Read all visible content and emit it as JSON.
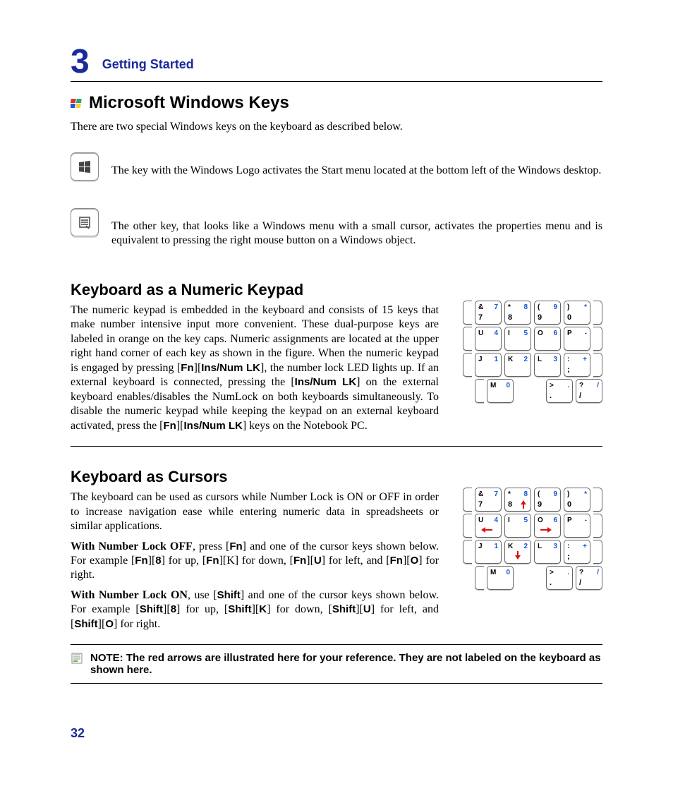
{
  "chapter": {
    "number": "3",
    "title": "Getting Started"
  },
  "section1": {
    "heading": "Microsoft Windows Keys",
    "intro": "There are two special Windows keys on the keyboard as described below.",
    "key1": "The key with the Windows Logo activates the Start menu located at the bottom left of the Windows desktop.",
    "key2": "The other key, that looks like a Windows menu with a small cursor, activates the properties menu and is equivalent to pressing the right mouse button on a Windows object."
  },
  "section2": {
    "heading": "Keyboard as a Numeric Keypad",
    "para_a": "The numeric keypad is embedded in the keyboard and consists of 15 keys that make number intensive input more convenient. These dual-purpose keys are labeled in orange on the key caps. Numeric assignments are located at the upper right hand corner of each key as shown in the figure. When the numeric keypad is engaged by pressing [",
    "para_b": "Fn",
    "para_c": "][",
    "para_d": "Ins/Num LK",
    "para_e": "], the number lock LED lights up. If an external keyboard is connected, pressing the [",
    "para_f": "Ins/Num LK",
    "para_g": "] on the external keyboard enables/disables the NumLock on both keyboards simultaneously. To disable the numeric keypad while keeping the keypad on an external keyboard activated, press the  [",
    "para_h": "Fn",
    "para_i": "][",
    "para_j": "Ins/Num LK",
    "para_k": "] keys on the Notebook PC."
  },
  "section3": {
    "heading": "Keyboard as Cursors",
    "p1": "The keyboard can be used as cursors while Number Lock is ON or OFF in order to increase navigation ease while entering numeric data in spreadsheets or similar applications.",
    "p2_a": "With Number Lock OFF",
    "p2_b": ", press [",
    "p2_c": "Fn",
    "p2_d": "] and one of the cursor keys shown below. For example [",
    "p2_e": "Fn",
    "p2_f": "][",
    "p2_g": "8",
    "p2_h": "] for up, [",
    "p2_i": "Fn",
    "p2_j": "][K] for down, [",
    "p2_k": "Fn",
    "p2_l": "][",
    "p2_m": "U",
    "p2_n": "] for left, and [",
    "p2_o": "Fn",
    "p2_p": "][",
    "p2_q": "O",
    "p2_r": "] for right.",
    "p3_a": "With Number Lock ON",
    "p3_b": ", use [",
    "p3_c": "Shift",
    "p3_d": "] and one of the cursor keys shown below. For example [",
    "p3_e": "Shift",
    "p3_f": "][",
    "p3_g": "8",
    "p3_h": "] for up, [",
    "p3_i": "Shift",
    "p3_j": "][",
    "p3_k": "K",
    "p3_l": "] for down, [",
    "p3_m": "Shift",
    "p3_n": "][",
    "p3_o": "U",
    "p3_p": "] for left, and [",
    "p3_q": "Shift",
    "p3_r": "][",
    "p3_s": "O",
    "p3_t": "] for right."
  },
  "note": "NOTE: The red arrows are illustrated here for your reference. They are not labeled on the keyboard as shown here.",
  "page_number": "32",
  "kbd": {
    "r1": [
      {
        "tl": "&",
        "tr": "7",
        "bl": "7"
      },
      {
        "tl": "*",
        "tr": "8",
        "bl": "8"
      },
      {
        "tl": "(",
        "tr": "9",
        "bl": "9"
      },
      {
        "tl": ")",
        "tr": "*",
        "bl": "0"
      }
    ],
    "r2": [
      {
        "tl": "U",
        "tr": "4"
      },
      {
        "tl": "I",
        "tr": "5"
      },
      {
        "tl": "O",
        "tr": "6"
      },
      {
        "tl": "P",
        "tr": "-"
      }
    ],
    "r3": [
      {
        "tl": "J",
        "tr": "1"
      },
      {
        "tl": "K",
        "tr": "2"
      },
      {
        "tl": "L",
        "tr": "3"
      },
      {
        "tl": ":",
        "tr": "+",
        "bl": ";"
      }
    ],
    "r4": [
      {
        "tl": "M",
        "tr": "0"
      },
      {
        "tl": ">",
        "tr": ".",
        "bl": "."
      },
      {
        "tl": "?",
        "tr": "/",
        "bl": "/"
      }
    ]
  }
}
